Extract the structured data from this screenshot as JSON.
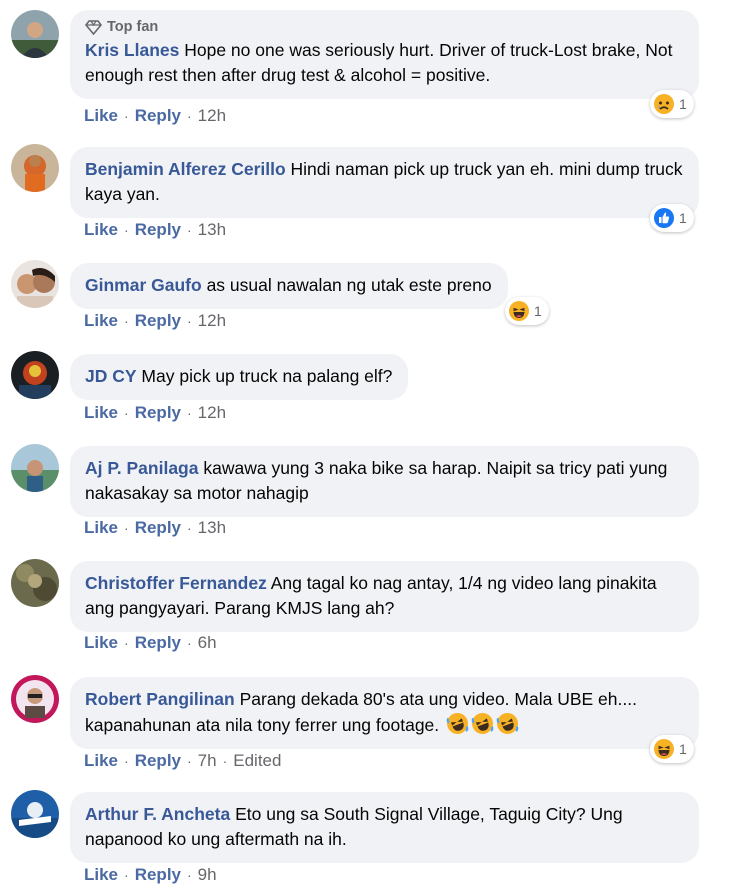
{
  "labels": {
    "top_fan": "Top fan",
    "like": "Like",
    "reply": "Reply",
    "edited": "Edited"
  },
  "comments": [
    {
      "author": "Kris Llanes",
      "text": "Hope no one was seriously hurt. Driver of truck-Lost brake, Not enough rest then after drug test & alcohol = positive.",
      "time": "12h",
      "reaction": {
        "icon": "sad-reaction-icon",
        "count": "1"
      }
    },
    {
      "author": "Benjamin Alferez Cerillo",
      "text": "Hindi naman pick up truck yan eh. mini dump truck kaya yan.",
      "time": "13h",
      "reaction": {
        "icon": "like-reaction-icon",
        "count": "1"
      }
    },
    {
      "author": "Ginmar Gaufo",
      "text": "as usual nawalan ng utak este preno",
      "time": "12h",
      "reaction": {
        "icon": "haha-reaction-icon",
        "count": "1"
      }
    },
    {
      "author": "JD CY",
      "text": "May pick up truck na palang elf?",
      "time": "12h"
    },
    {
      "author": "Aj P. Panilaga",
      "text": "kawawa yung 3 naka bike sa harap. Naipit sa tricy pati yung nakasakay sa motor nahagip",
      "time": "13h"
    },
    {
      "author": "Christoffer Fernandez",
      "text": "Ang tagal ko nag antay, 1/4 ng video lang pinakita ang pangyayari. Parang KMJS lang ah?",
      "time": "6h"
    },
    {
      "author": "Robert Pangilinan",
      "text": "Parang dekada 80's ata ung video. Mala UBE eh.... kapanahunan ata nila tony ferrer ung footage.",
      "time": "7h",
      "emojis": [
        "rofl-emoji",
        "rofl-emoji",
        "rofl-emoji"
      ],
      "reaction": {
        "icon": "haha-reaction-icon",
        "count": "1"
      }
    },
    {
      "author": "Arthur F. Ancheta",
      "text": "Eto ung sa South Signal Village, Taguig City? Ung napanood ko ung aftermath na ih.",
      "time": "9h"
    }
  ],
  "colors": {
    "author": "#385898",
    "bubble": "#f0f2f5",
    "meta": "#65676b"
  }
}
